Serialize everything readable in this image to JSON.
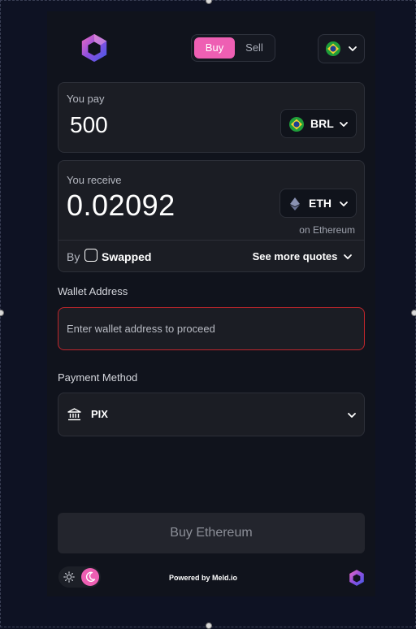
{
  "header": {
    "tabs": {
      "buy": "Buy",
      "sell": "Sell"
    },
    "country_flag": "brazil-flag-icon"
  },
  "pay": {
    "label": "You pay",
    "amount": "500",
    "currency": "BRL"
  },
  "receive": {
    "label": "You receive",
    "amount": "0.02092",
    "currency": "ETH",
    "network": "on Ethereum"
  },
  "provider": {
    "by": "By",
    "name": "Swapped",
    "more_quotes": "See more quotes"
  },
  "wallet": {
    "label": "Wallet Address",
    "placeholder": "Enter wallet address to proceed"
  },
  "payment": {
    "label": "Payment Method",
    "method": "PIX"
  },
  "action": {
    "buy_label": "Buy Ethereum"
  },
  "footer": {
    "powered": "Powered by Meld.io"
  },
  "colors": {
    "accent": "#ee5fb3",
    "background": "#10131c",
    "card": "#1b1d24",
    "error_border": "#c0262c"
  }
}
